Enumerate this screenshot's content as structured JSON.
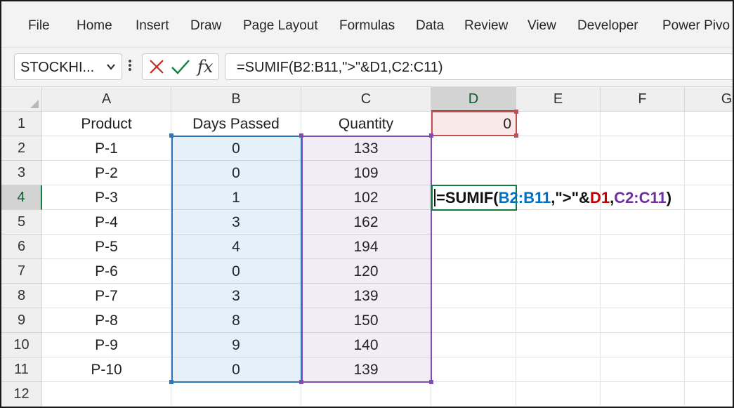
{
  "ribbon": {
    "tabs": [
      "File",
      "Home",
      "Insert",
      "Draw",
      "Page Layout",
      "Formulas",
      "Data",
      "Review",
      "View",
      "Developer",
      "Power Pivo"
    ]
  },
  "formula_bar": {
    "name_box": "STOCKHI...",
    "name_box_arrow_icon": "chevron-down-icon",
    "more_icon": "vertical-ellipsis-icon",
    "cancel_icon": "close-icon",
    "enter_icon": "checkmark-icon",
    "fx_label": "fx",
    "formula": "=SUMIF(B2:B11,\">\"&D1,C2:C11)"
  },
  "grid": {
    "columns": [
      "A",
      "B",
      "C",
      "D",
      "E",
      "F",
      "G"
    ],
    "active_column": "D",
    "active_row": "4",
    "rows": [
      "1",
      "2",
      "3",
      "4",
      "5",
      "6",
      "7",
      "8",
      "9",
      "10",
      "11",
      "12"
    ],
    "data": [
      [
        "Product",
        "Days Passed",
        "Quantity",
        "0"
      ],
      [
        "P-1",
        "0",
        "133",
        ""
      ],
      [
        "P-2",
        "0",
        "109",
        ""
      ],
      [
        "P-3",
        "1",
        "102",
        ""
      ],
      [
        "P-4",
        "3",
        "162",
        ""
      ],
      [
        "P-5",
        "4",
        "194",
        ""
      ],
      [
        "P-6",
        "0",
        "120",
        ""
      ],
      [
        "P-7",
        "3",
        "139",
        ""
      ],
      [
        "P-8",
        "8",
        "150",
        ""
      ],
      [
        "P-9",
        "9",
        "140",
        ""
      ],
      [
        "P-10",
        "0",
        "139",
        ""
      ],
      [
        "",
        "",
        "",
        ""
      ]
    ],
    "edit_formula_parts": [
      {
        "text": "=SUMIF(",
        "color": "#111111"
      },
      {
        "text": "B2:B11",
        "color": "#0070c0"
      },
      {
        "text": ",\">\"&",
        "color": "#111111"
      },
      {
        "text": "D1",
        "color": "#c00000"
      },
      {
        "text": ",",
        "color": "#111111"
      },
      {
        "text": "C2:C11",
        "color": "#7030a0"
      },
      {
        "text": ")",
        "color": "#111111"
      }
    ]
  },
  "colors": {
    "ribbon_bg": "#f3f3f3",
    "excel_green": "#107c41",
    "range_b": "#2e75b6",
    "range_c": "#7f4fb0",
    "range_d": "#c0504d"
  }
}
